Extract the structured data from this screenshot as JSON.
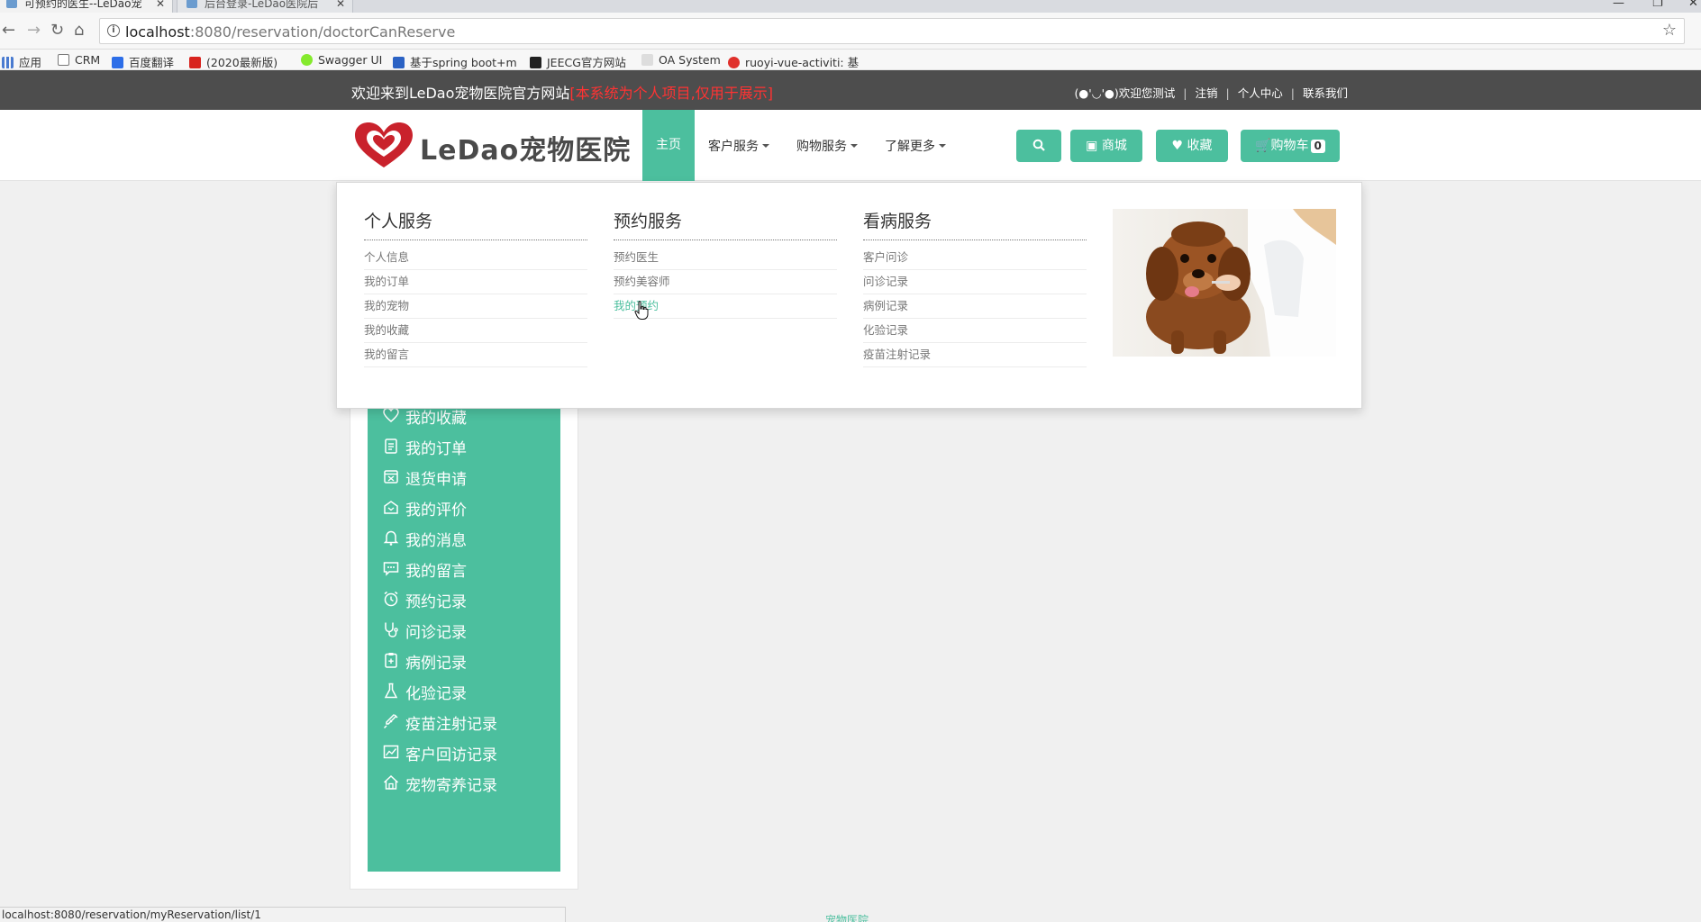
{
  "browser": {
    "tabs": [
      {
        "title": "可预约的医生--LeDao宠",
        "active": true
      },
      {
        "title": "后台登录-LeDao医院后",
        "active": false
      }
    ],
    "url_host": "localhost",
    "url_path": ":8080/reservation/doctorCanReserve",
    "bookmarks": [
      "应用",
      "CRM",
      "百度翻译",
      "(2020最新版)",
      "Swagger UI",
      "基于spring boot+m",
      "JEECG官方网站",
      "OA System",
      "ruoyi-vue-activiti: 基"
    ],
    "status_url": "localhost:8080/reservation/myReservation/list/1"
  },
  "topbar": {
    "welcome": "欢迎来到LeDao宠物医院官方网站",
    "notice": "[本系统为个人项目,仅用于展示]",
    "user_greeting": "(●'◡'●)欢迎您测试",
    "logout": "注销",
    "personal_center": "个人中心",
    "contact": "联系我们"
  },
  "nav": {
    "logo_text": "LeDao宠物医院",
    "home": "主页",
    "customer_service": "客户服务",
    "shopping_service": "购物服务",
    "learn_more": "了解更多",
    "mall": "商城",
    "favorites": "收藏",
    "cart": "购物车",
    "cart_count": "0"
  },
  "mega": {
    "columns": [
      {
        "title": "个人服务",
        "items": [
          "个人信息",
          "我的订单",
          "我的宠物",
          "我的收藏",
          "我的留言"
        ]
      },
      {
        "title": "预约服务",
        "items": [
          "预约医生",
          "预约美容师",
          "我的预约"
        ]
      },
      {
        "title": "看病服务",
        "items": [
          "客户问诊",
          "问诊记录",
          "病例记录",
          "化验记录",
          "疫苗注射记录"
        ]
      }
    ]
  },
  "sidebar": {
    "items": [
      "我的收藏",
      "我的订单",
      "退货申请",
      "我的评价",
      "我的消息",
      "我的留言",
      "预约记录",
      "问诊记录",
      "病例记录",
      "化验记录",
      "疫苗注射记录",
      "客户回访记录",
      "宠物寄养记录"
    ]
  },
  "footer_peek": "宠物医院",
  "colors": {
    "accent": "#4cbf9e",
    "topbar": "#4d4d4d",
    "notice": "#ff3333"
  }
}
